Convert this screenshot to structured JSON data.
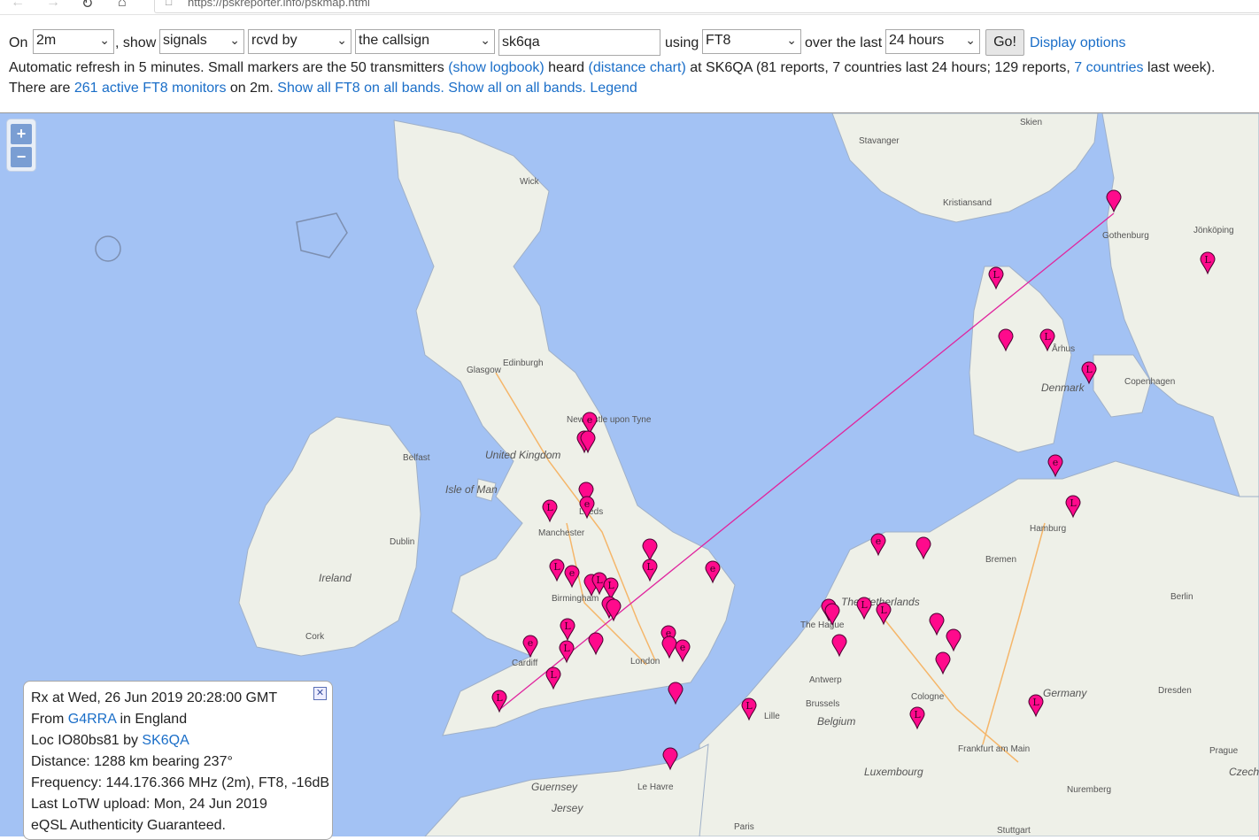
{
  "browser": {
    "url": "https://pskreporter.info/pskmap.html",
    "back_glyph": "←",
    "forward_glyph": "→",
    "reload_glyph": "↻",
    "home_glyph": "⌂",
    "lock_glyph": "🔒"
  },
  "controls": {
    "on_label": "On",
    "band_value": "2m",
    "show_label": ", show",
    "signals_value": "signals",
    "rcvd_value": "rcvd by",
    "callsign_mode_value": "the callsign",
    "callsign_input_value": "sk6qa",
    "using_label": "using",
    "mode_value": "FT8",
    "over_label": "over the last",
    "period_value": "24 hours",
    "go_label": "Go!",
    "display_options_link": "Display options"
  },
  "info": {
    "line1_a": "Automatic refresh in 5 minutes. Small markers are the 50 transmitters",
    "logbook_link": "(show logbook)",
    "heard": "heard",
    "distance_link": "(distance chart)",
    "line1_b": "at SK6QA (81 reports, 7 countries last 24 hours; 129 reports,",
    "countries_link": "7 countries",
    "line1_c": "last week).",
    "line2_a": "There are",
    "monitors_link": "261 active FT8 monitors",
    "line2_b": "on 2m.",
    "all_ft8_link": "Show all FT8 on all bands.",
    "all_link": "Show all on all bands.",
    "legend_link": "Legend"
  },
  "map": {
    "zoom_in": "+",
    "zoom_out": "−",
    "labels": {
      "skien": "Skien",
      "stavanger": "Stavanger",
      "kristiansand": "Kristiansand",
      "gothenburg": "Gothenburg",
      "jonkoping": "Jönköping",
      "wick": "Wick",
      "aarhus": "Århus",
      "denmark": "Denmark",
      "copenhagen": "Copenhagen",
      "glasgow": "Glasgow",
      "edinburgh": "Edinburgh",
      "newcastle": "Newcastle upon Tyne",
      "uk": "United Kingdom",
      "belfast": "Belfast",
      "isle_of_man": "Isle of Man",
      "leeds": "Leeds",
      "manchester": "Manchester",
      "dublin": "Dublin",
      "ireland": "Ireland",
      "birmingham": "Birmingham",
      "cork": "Cork",
      "cardiff": "Cardiff",
      "london": "London",
      "hamburg": "Hamburg",
      "bremen": "Bremen",
      "berlin": "Berlin",
      "netherlands": "The Netherlands",
      "the_hague": "The Hague",
      "antwerp": "Antwerp",
      "brussels": "Brussels",
      "belgium": "Belgium",
      "lille": "Lille",
      "cologne": "Cologne",
      "germany": "Germany",
      "dresden": "Dresden",
      "frankfurt": "Frankfurt am Main",
      "prague": "Prague",
      "czech": "Czech",
      "luxembourg": "Luxembourg",
      "nuremberg": "Nuremberg",
      "guernsey": "Guernsey",
      "jersey": "Jersey",
      "le_havre": "Le Havre",
      "paris": "Paris",
      "stuttgart": "Stuttgart"
    },
    "marker_color": "#ff0a8c",
    "path_color": "#e0259e"
  },
  "popup": {
    "rx_line": "Rx at Wed, 26 Jun 2019 20:28:00 GMT",
    "from_label": "From",
    "from_call": "G4RRA",
    "from_country": "in England",
    "loc_label": "Loc IO80bs81 by",
    "loc_call": "SK6QA",
    "distance": "Distance: 1288 km bearing 237°",
    "frequency": "Frequency: 144.176.366 MHz (2m), FT8, -16dB",
    "lotw": "Last LoTW upload: Mon, 24 Jun 2019",
    "eqsl": "eQSL Authenticity Guaranteed.",
    "close_glyph": "✕"
  }
}
